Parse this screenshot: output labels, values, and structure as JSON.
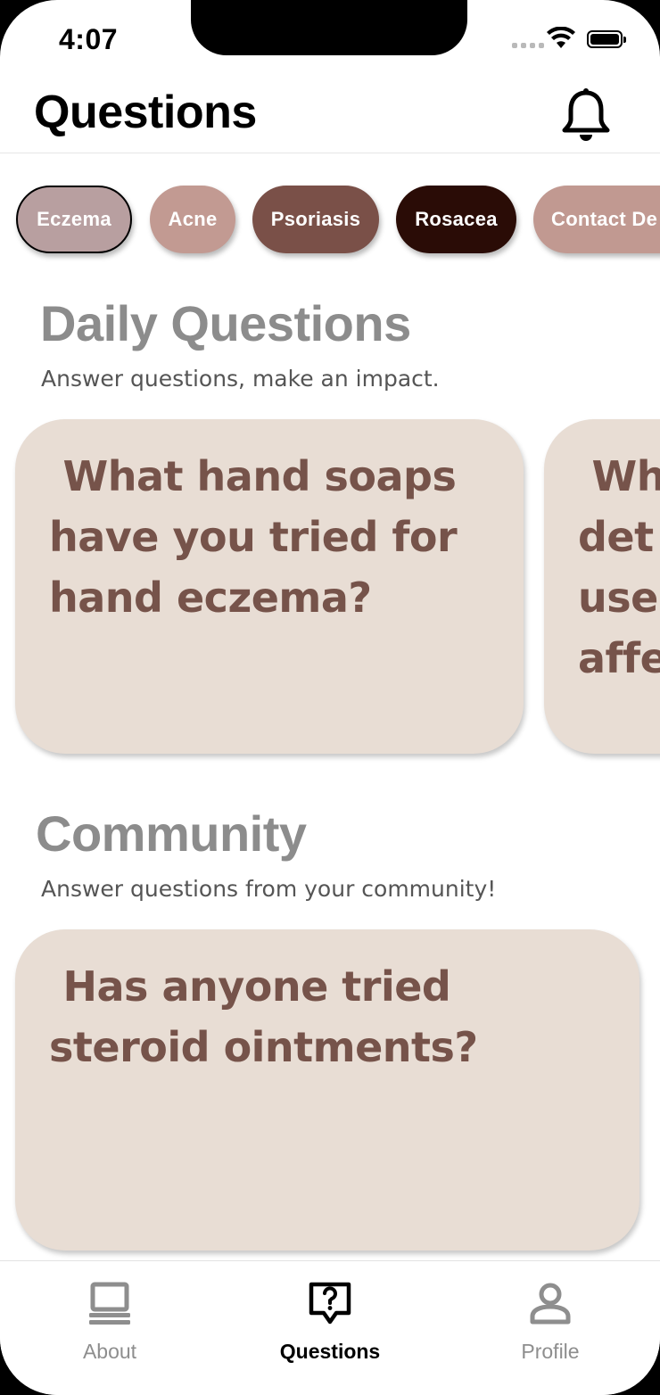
{
  "status_bar": {
    "time": "4:07"
  },
  "header": {
    "title": "Questions"
  },
  "filters": {
    "chips": [
      {
        "label": "Eczema",
        "bg": "#b89fa0",
        "selected": true
      },
      {
        "label": "Acne",
        "bg": "#c29a92",
        "selected": false
      },
      {
        "label": "Psoriasis",
        "bg": "#7a5048",
        "selected": false
      },
      {
        "label": "Rosacea",
        "bg": "#2a0c06",
        "selected": false
      },
      {
        "label": "Contact De",
        "bg": "#c19991",
        "selected": false
      }
    ]
  },
  "daily": {
    "title": "Daily Questions",
    "subtitle": "Answer questions, make an impact.",
    "cards": [
      {
        "lines": " What hand soaps\nhave you tried for\nhand eczema?"
      },
      {
        "lines": " Wh\ndet\nuse\naffe"
      }
    ]
  },
  "community": {
    "title": "Community",
    "subtitle": "Answer questions from your community!",
    "cards": [
      {
        "lines": " Has anyone tried\nsteroid ointments?"
      }
    ]
  },
  "tabbar": {
    "tabs": [
      {
        "label": "About",
        "icon": "laptop-icon",
        "active": false
      },
      {
        "label": "Questions",
        "icon": "question-bubble-icon",
        "active": true
      },
      {
        "label": "Profile",
        "icon": "person-icon",
        "active": false
      }
    ]
  },
  "colors": {
    "card_bg": "#e8ddd4",
    "card_text": "#76534a",
    "section_title": "#8c8c8c",
    "tab_inactive": "#8e8e8e",
    "tab_active": "#000000"
  }
}
